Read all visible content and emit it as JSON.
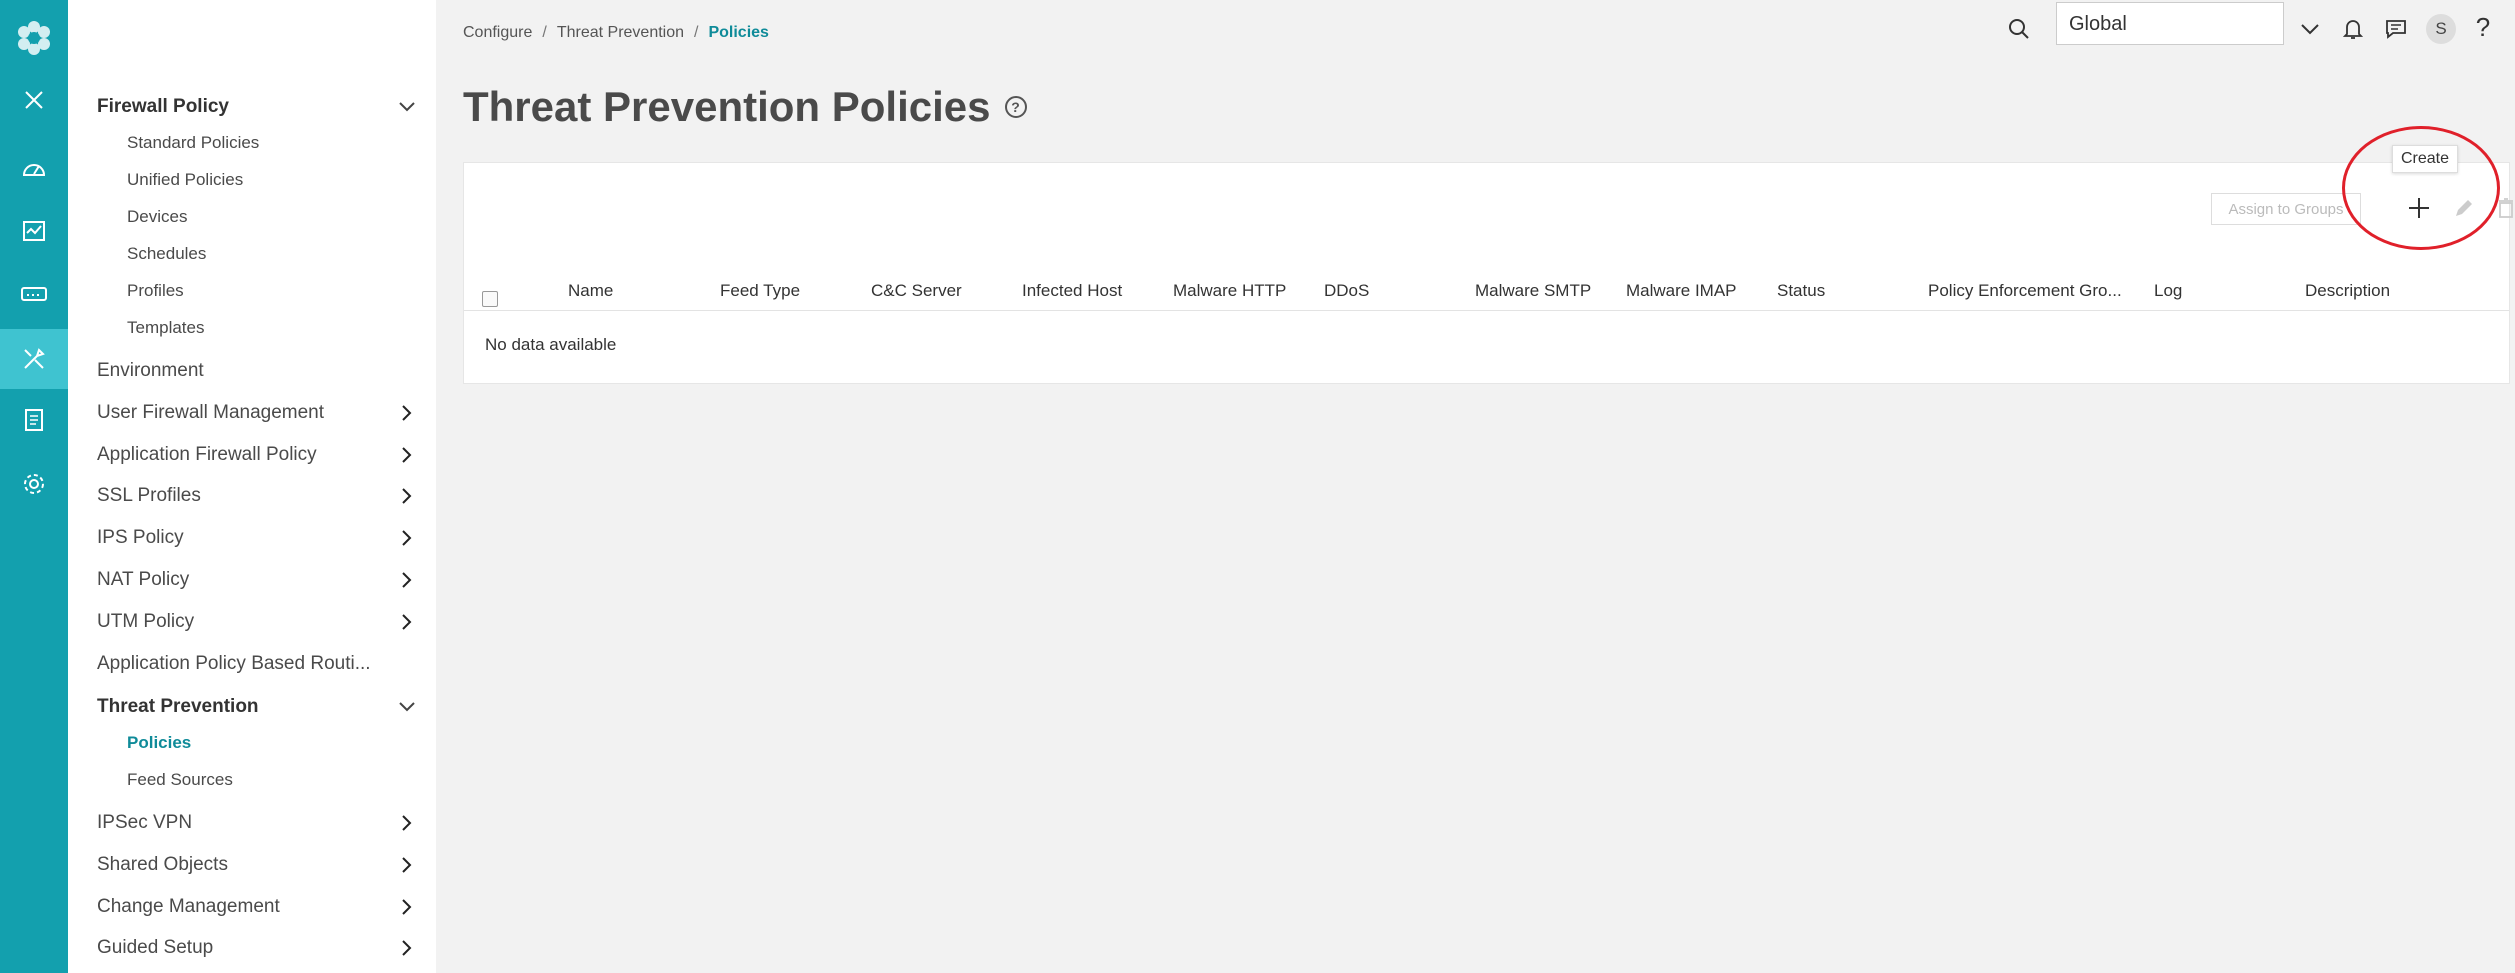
{
  "rail": {
    "icons": [
      "logo-icon",
      "close-icon",
      "dashboard-icon",
      "monitor-icon",
      "devices-icon",
      "configure-icon",
      "reports-icon",
      "administration-icon"
    ]
  },
  "nav": {
    "firewall_policy": "Firewall Policy",
    "firewall_sub": [
      "Standard Policies",
      "Unified Policies",
      "Devices",
      "Schedules",
      "Profiles",
      "Templates"
    ],
    "environment": "Environment",
    "user_firewall": "User Firewall Management",
    "app_firewall": "Application Firewall Policy",
    "ssl_profiles": "SSL Profiles",
    "ips_policy": "IPS Policy",
    "nat_policy": "NAT Policy",
    "utm_policy": "UTM Policy",
    "app_routing": "Application Policy Based Routi...",
    "threat_prevention": "Threat Prevention",
    "threat_sub": [
      "Policies",
      "Feed Sources"
    ],
    "ipsec_vpn": "IPSec VPN",
    "shared_objects": "Shared Objects",
    "change_mgmt": "Change Management",
    "guided_setup": "Guided Setup"
  },
  "breadcrumb": {
    "items": [
      "Configure",
      "Threat Prevention",
      "Policies"
    ],
    "sep": "/"
  },
  "header": {
    "title": "Threat Prevention Policies",
    "help": "?",
    "scope": "Global",
    "avatar": "S",
    "help_top": "?"
  },
  "toolbar": {
    "assign": "Assign to Groups",
    "tooltip": "Create"
  },
  "table": {
    "columns": [
      "Name",
      "Feed Type",
      "C&C Server",
      "Infected Host",
      "Malware HTTP",
      "DDoS",
      "Malware SMTP",
      "Malware IMAP",
      "Status",
      "Policy Enforcement Gro...",
      "Log",
      "Description"
    ],
    "empty": "No data available"
  }
}
